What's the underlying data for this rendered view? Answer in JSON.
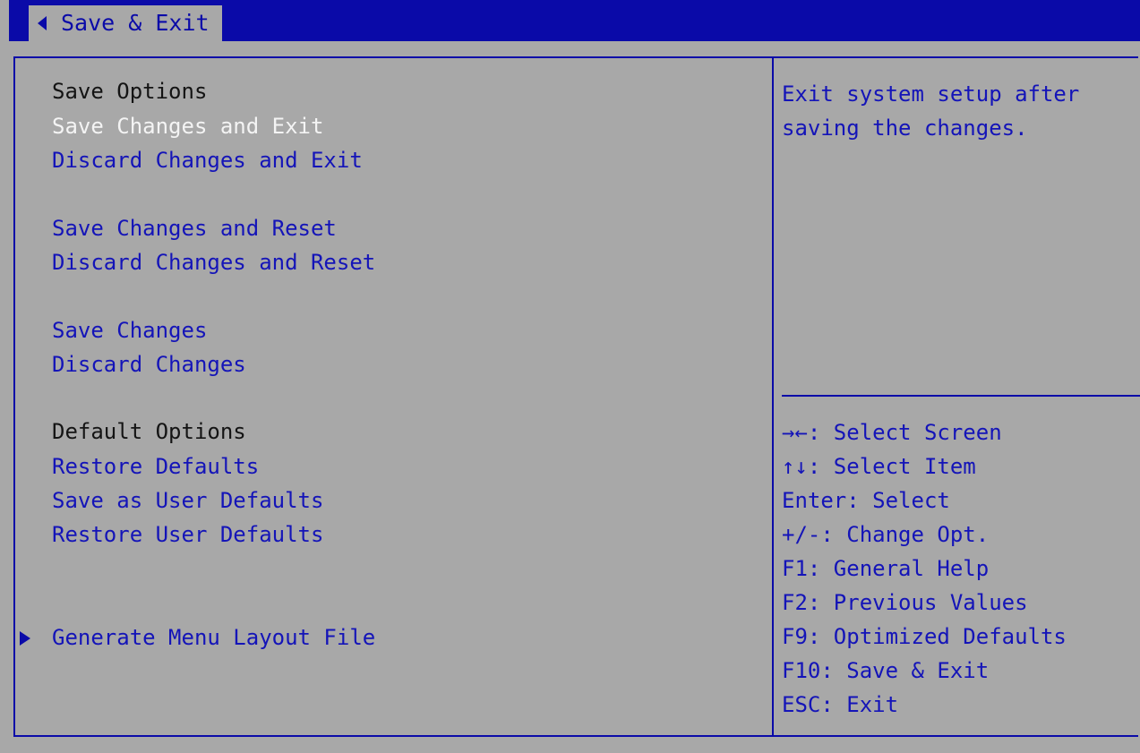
{
  "colors": {
    "background": "#a8a8a8",
    "accent_blue": "#0a0aa8",
    "item_text": "#1414b8",
    "header_text": "#141414",
    "selected_text": "#f4f4f4"
  },
  "tab": {
    "label": "Save & Exit",
    "icon": "left-arrow-icon"
  },
  "menu": {
    "save_options_header": "Save Options",
    "save_changes_and_exit": "Save Changes and Exit",
    "discard_changes_and_exit": "Discard Changes and Exit",
    "save_changes_and_reset": "Save Changes and Reset",
    "discard_changes_and_reset": "Discard Changes and Reset",
    "save_changes": "Save Changes",
    "discard_changes": "Discard Changes",
    "default_options_header": "Default Options",
    "restore_defaults": "Restore Defaults",
    "save_as_user_defaults": "Save as User Defaults",
    "restore_user_defaults": "Restore User Defaults",
    "generate_menu_layout_file": "Generate Menu Layout File",
    "submenu_icon": "right-triangle-icon"
  },
  "help": {
    "description": "Exit system setup after\nsaving the changes."
  },
  "hints": [
    "→←: Select Screen",
    "↑↓: Select Item",
    "Enter: Select",
    "+/-: Change Opt.",
    "F1: General Help",
    "F2: Previous Values",
    "F9: Optimized Defaults",
    "F10: Save & Exit",
    "ESC: Exit"
  ]
}
